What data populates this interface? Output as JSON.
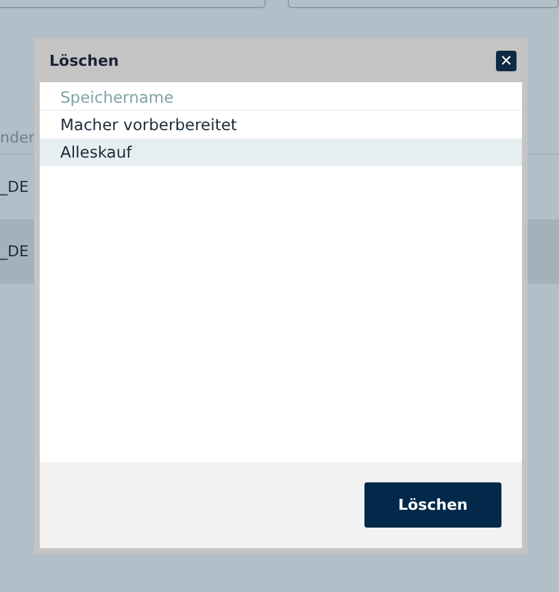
{
  "background": {
    "column_label": "nder",
    "rows": [
      {
        "text": "_DE",
        "selected": false
      },
      {
        "text": "_DE",
        "selected": true
      }
    ]
  },
  "dialog": {
    "title": "Löschen",
    "close": "✕",
    "list": {
      "header": "Speichername",
      "rows": [
        {
          "label": "Macher vorberbereitet",
          "selected": false
        },
        {
          "label": "Alleskauf",
          "selected": true
        }
      ]
    },
    "button": "Löschen"
  }
}
